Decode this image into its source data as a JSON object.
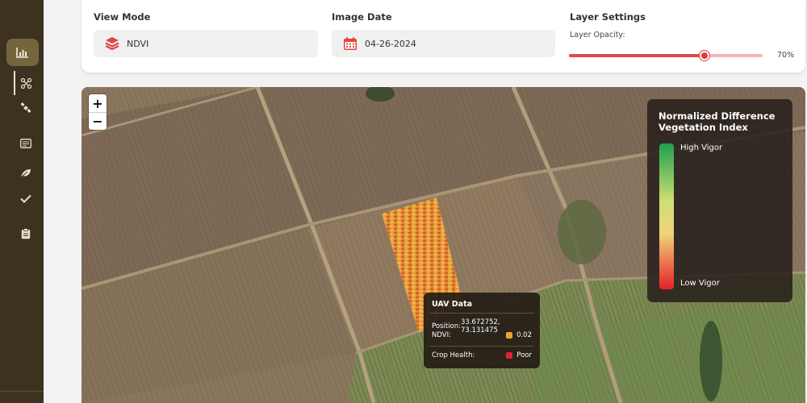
{
  "header": {
    "view_mode": {
      "title": "View Mode",
      "value": "NDVI",
      "icon": "layers-icon"
    },
    "image_date": {
      "title": "Image Date",
      "value": "04-26-2024",
      "icon": "calendar-icon"
    },
    "layer_settings": {
      "title": "Layer Settings",
      "opacity_label": "Layer Opacity:",
      "opacity_value": "70%",
      "opacity_fraction": 0.7
    }
  },
  "sidebar": {
    "items": [
      {
        "name": "analytics",
        "icon": "bar-chart-icon",
        "active": true
      },
      {
        "name": "drone",
        "icon": "drone-icon",
        "active": false
      },
      {
        "name": "satellite",
        "icon": "satellite-icon",
        "active": false
      },
      {
        "name": "list",
        "icon": "list-icon",
        "active": false
      },
      {
        "name": "crop",
        "icon": "leaf-icon",
        "active": false
      },
      {
        "name": "approve",
        "icon": "check-icon",
        "active": false
      },
      {
        "name": "reports",
        "icon": "clipboard-icon",
        "active": false
      }
    ]
  },
  "map": {
    "zoom_in": "+",
    "zoom_out": "−",
    "legend": {
      "title": "Normalized Difference Vegetation Index",
      "high_label": "High Vigor",
      "low_label": "Low Vigor"
    },
    "tooltip": {
      "title": "UAV Data",
      "position_label": "Position:",
      "position_value": "33.672752, 73.131475",
      "ndvi_label": "NDVI:",
      "ndvi_value": "0.02",
      "crop_health_label": "Crop Health:",
      "crop_health_value": "Poor"
    }
  },
  "colors": {
    "sidebar_bg": "#3d3220",
    "accent_red": "#e03b3b",
    "ndvi_swatch": "#f2a22c",
    "poor_swatch": "#e3212a"
  }
}
